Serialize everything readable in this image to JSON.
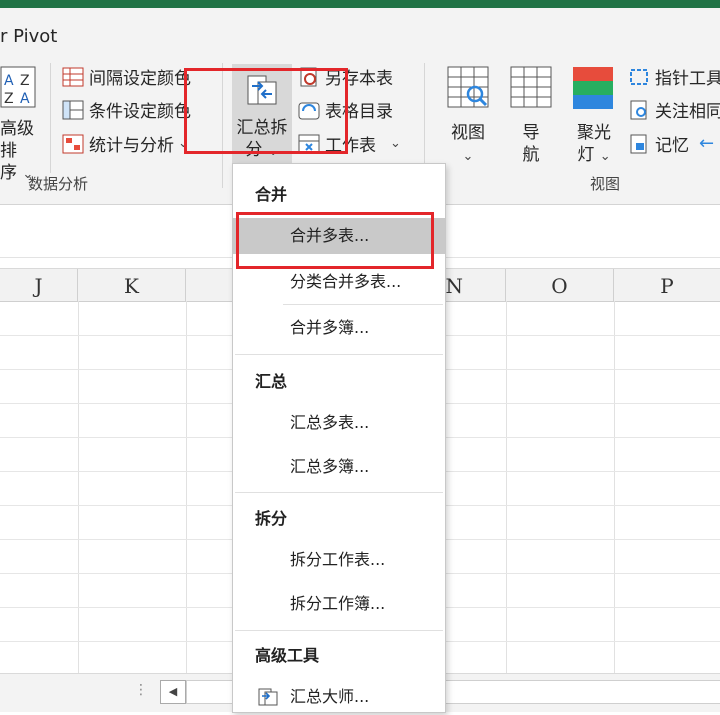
{
  "ribbon": {
    "tab_title": "r Pivot",
    "sort_button": {
      "line1": "高级排",
      "line2": "序"
    },
    "group1_items": [
      "间隔设定颜色",
      "条件设定颜色",
      "统计与分析"
    ],
    "group1_label": "数据分析",
    "summarize_button": {
      "line1": "汇总拆",
      "line2": "分"
    },
    "group2_items": [
      "另存本表",
      "表格目录",
      "工作表"
    ],
    "view_buttons": [
      {
        "label": "视图",
        "sub": ""
      },
      {
        "label": "导",
        "sub": "航"
      },
      {
        "label": "聚光",
        "sub": "灯"
      }
    ],
    "group3_items": [
      "指针工具",
      "关注相同",
      "记忆"
    ],
    "view_group_label": "视图"
  },
  "columns": [
    "J",
    "K",
    "N",
    "O",
    "P"
  ],
  "dropdown": {
    "sections": [
      {
        "header": "合并",
        "items": [
          "合并多表...",
          "分类合并多表...",
          "合并多簿..."
        ]
      },
      {
        "header": "汇总",
        "items": [
          "汇总多表...",
          "汇总多簿..."
        ]
      },
      {
        "header": "拆分",
        "items": [
          "拆分工作表...",
          "拆分工作簿..."
        ]
      },
      {
        "header": "高级工具",
        "items": [
          "汇总大师..."
        ]
      }
    ],
    "highlighted_item": "合并多表..."
  },
  "colors": {
    "accent": "#217346",
    "highlight_border": "#e3262a",
    "menu_hover": "#c9c9c9"
  }
}
